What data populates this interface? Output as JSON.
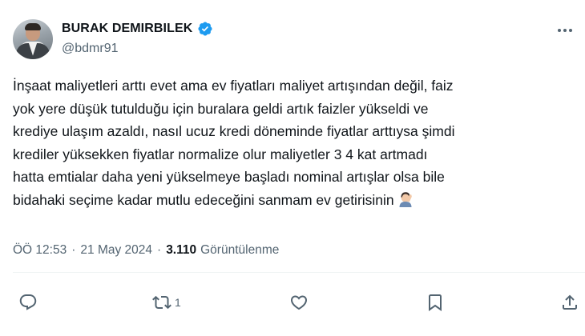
{
  "author": {
    "display_name": "BURAK DEMIRBILEK",
    "handle": "@bdmr91",
    "verified": true,
    "verified_color": "#1d9bf0"
  },
  "tweet": {
    "text": "İnşaat maliyetleri arttı evet ama ev fiyatları maliyet artışından değil, faiz\nyok yere düşük tutulduğu için buralara geldi artık faizler yükseldi ve\nkrediye ulaşım azaldı, nasıl ucuz kredi döneminde fiyatlar arttıysa şimdi\nkrediler yüksekken fiyatlar normalize olur maliyetler 3 4 kat artmadı\nhatta emtialar daha yeni yükselmeye başladı nominal artışlar olsa bile\nbidahaki seçime kadar mutlu edeceğini sanmam ev getirisinin",
    "trailing_emoji": "person-facepalming-emoji"
  },
  "meta": {
    "time": "ÖÖ 12:53",
    "separator": "·",
    "date": "21 May 2024",
    "views_count": "3.110",
    "views_label": "Görüntülenme"
  },
  "actions": {
    "reply_count": "",
    "retweet_count": "1",
    "like_count": "",
    "icons": [
      "reply-icon",
      "retweet-icon",
      "like-icon",
      "bookmark-icon",
      "share-icon"
    ]
  },
  "colors": {
    "text_primary": "#0f1419",
    "text_secondary": "#536471",
    "divider": "#eff3f4"
  }
}
